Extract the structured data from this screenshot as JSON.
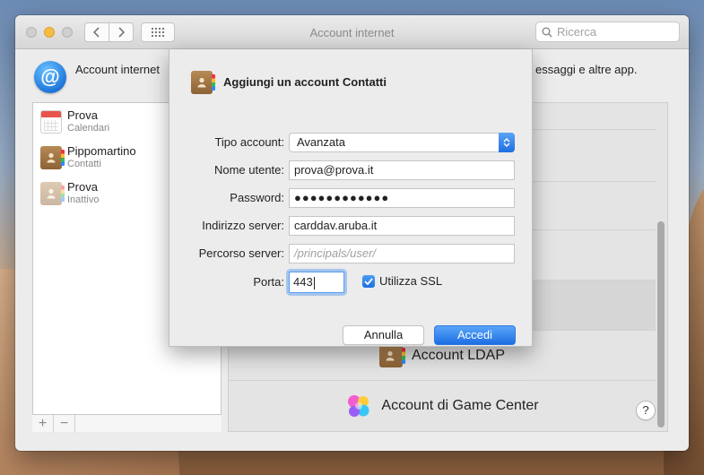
{
  "window": {
    "title": "Account internet",
    "search_placeholder": "Ricerca"
  },
  "header": {
    "text_left": "Account internet",
    "text_right": "essaggi e altre app."
  },
  "accounts": [
    {
      "name": "Prova",
      "subtitle": "Calendari",
      "icon": "calendar-icon"
    },
    {
      "name": "Pippomartino",
      "subtitle": "Contatti",
      "icon": "contacts-icon"
    },
    {
      "name": "Prova",
      "subtitle": "Inattivo",
      "icon": "contacts-icon"
    }
  ],
  "sidebar_footer": {
    "add": "+",
    "remove": "−"
  },
  "providers": [
    {
      "label": "Account LDAP",
      "icon": "contacts-icon"
    },
    {
      "label": "Account di Game Center",
      "icon": "game-center-icon"
    }
  ],
  "help": "?",
  "dialog": {
    "title": "Aggiungi un account Contatti",
    "fields": {
      "account_type": {
        "label": "Tipo account:",
        "value": "Avanzata"
      },
      "username": {
        "label": "Nome utente:",
        "value": "prova@prova.it"
      },
      "password": {
        "label": "Password:",
        "value": "●●●●●●●●●●●●"
      },
      "server_address": {
        "label": "Indirizzo server:",
        "value": "carddav.aruba.it"
      },
      "server_path": {
        "label": "Percorso server:",
        "placeholder": "/principals/user/"
      },
      "port": {
        "label": "Porta:",
        "value": "443"
      }
    },
    "ssl": {
      "label": "Utilizza SSL",
      "checked": true
    },
    "cancel": "Annulla",
    "ok": "Accedi"
  },
  "colors": {
    "accent": "#1e6fe0",
    "traffic_yellow": "#f5bc42"
  }
}
